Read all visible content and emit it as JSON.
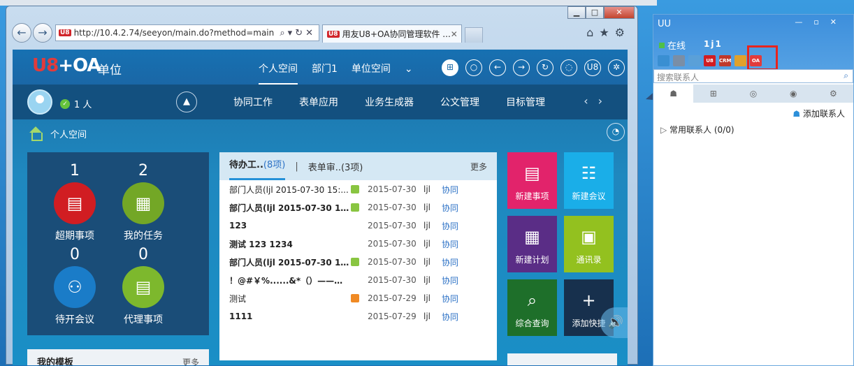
{
  "browser": {
    "url": "http://10.4.2.74/seeyon/main.do?method=main",
    "tab_title": "用友U8+OA协同管理软件 ...",
    "tab_badge": "U8",
    "url_badge": "U8"
  },
  "app": {
    "logo_text": "U8",
    "logo_plus": "+OA",
    "unit_label": "单位",
    "top_nav": [
      "个人空间",
      "部门1",
      "单位空间"
    ],
    "online_count": "1 人",
    "menu": [
      "协同工作",
      "表单应用",
      "业务生成器",
      "公文管理",
      "目标管理"
    ],
    "breadcrumb": "个人空间",
    "stats": [
      {
        "count": "1",
        "label": "超期事项",
        "color": "#d11d22"
      },
      {
        "count": "2",
        "label": "我的任务",
        "color": "#73a726"
      },
      {
        "count": "0",
        "label": "待开会议",
        "color": "#1a7cc8"
      },
      {
        "count": "0",
        "label": "代理事项",
        "color": "#7db82d"
      }
    ],
    "templates_title": "我的模板",
    "templates_more": "更多",
    "pending": {
      "tab1": "待办工..",
      "tab1_count": "(8项)",
      "separator": "|",
      "tab2": "表单审..(3项)",
      "more": "更多",
      "rows": [
        {
          "title": "部门人员(ljl 2015-07-30 15:...",
          "bold": false,
          "icon": "green",
          "date": "2015-07-30",
          "user": "ljl",
          "type": "协同"
        },
        {
          "title": "部门人员(ljl 2015-07-30 15...",
          "bold": true,
          "icon": "green",
          "date": "2015-07-30",
          "user": "ljl",
          "type": "协同"
        },
        {
          "title": "123",
          "bold": true,
          "icon": "",
          "date": "2015-07-30",
          "user": "ljl",
          "type": "协同"
        },
        {
          "title": "测试 123  1234",
          "bold": true,
          "icon": "",
          "date": "2015-07-30",
          "user": "ljl",
          "type": "协同"
        },
        {
          "title": "部门人员(ljl 2015-07-30 10...",
          "bold": true,
          "icon": "green",
          "date": "2015-07-30",
          "user": "ljl",
          "type": "协同"
        },
        {
          "title": "！@#￥%......&*（）——+}{“...",
          "bold": true,
          "icon": "",
          "date": "2015-07-30",
          "user": "ljl",
          "type": "协同"
        },
        {
          "title": "测试",
          "bold": false,
          "icon": "orange",
          "date": "2015-07-29",
          "user": "ljl",
          "type": "协同"
        },
        {
          "title": "1111",
          "bold": true,
          "icon": "",
          "date": "2015-07-29",
          "user": "ljl",
          "type": "协同"
        }
      ]
    },
    "tiles": [
      {
        "label": "新建事项",
        "glyph": "▤",
        "color": "#e2236b"
      },
      {
        "label": "新建会议",
        "glyph": "☷",
        "color": "#1aaee8"
      },
      {
        "label": "新建计划",
        "glyph": "▦",
        "color": "#5a2d86"
      },
      {
        "label": "通讯录",
        "glyph": "▣",
        "color": "#93c11f"
      },
      {
        "label": "综合查询",
        "glyph": "⌕",
        "color": "#1e6f2a"
      },
      {
        "label": "添加快捷",
        "glyph": "+",
        "color": "#17304d"
      }
    ]
  },
  "uu": {
    "title": "UU",
    "status": "在线",
    "username": "1j1",
    "search_placeholder": "搜索联系人",
    "add_contact": "添加联系人",
    "group": "常用联系人 (0/0)",
    "tool_icons": [
      {
        "name": "doc-icon",
        "color": "#3a8fd2",
        "label": ""
      },
      {
        "name": "printer-icon",
        "color": "#7a8ea6",
        "label": ""
      },
      {
        "name": "chat-icon",
        "color": "#5aa0d8",
        "label": ""
      },
      {
        "name": "u8-icon",
        "color": "#d11d22",
        "label": "U8"
      },
      {
        "name": "crm-icon",
        "color": "#c0392b",
        "label": "CRM"
      },
      {
        "name": "refresh-icon",
        "color": "#e1a12b",
        "label": ""
      },
      {
        "name": "oa-icon",
        "color": "#e23b3b",
        "label": "OA"
      }
    ]
  }
}
